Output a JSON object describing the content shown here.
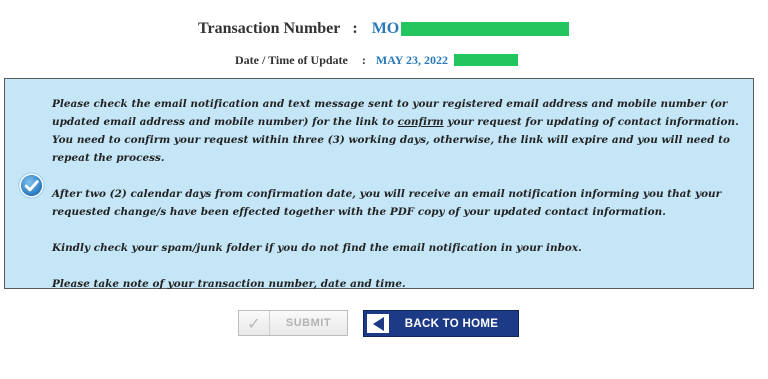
{
  "header": {
    "transaction_label": "Transaction Number",
    "colon": ":",
    "transaction_value": "MO",
    "date_label": "Date / Time of Update",
    "date_value": "MAY 23, 2022"
  },
  "info": {
    "icon": "check-circle-icon",
    "p1_before": "Please check the email notification and text message sent to your registered email address and mobile number (or updated email address and mobile number) for the link to ",
    "p1_link": "confirm",
    "p1_after": " your request for updating of contact information. You need to confirm your request within three (3) working days, otherwise, the link will expire and you will need to repeat the process.",
    "p2": "After two (2) calendar days from confirmation date, you will receive an email notification informing you that your requested change/s have been effected together with the PDF copy of your updated contact information.",
    "p3": "Kindly check your spam/junk folder if you do not find the email notification in your inbox.",
    "p4": "Please take note of your transaction number, date and time."
  },
  "buttons": {
    "submit_label": "SUBMIT",
    "submit_icon": "check-icon",
    "back_label": "BACK TO HOME",
    "back_icon": "arrow-left-icon"
  },
  "colors": {
    "info_background": "#c4e6f7",
    "value_blue": "#2a7ab8",
    "button_navy": "#1c3a86",
    "redaction_green": "#22c55e"
  }
}
